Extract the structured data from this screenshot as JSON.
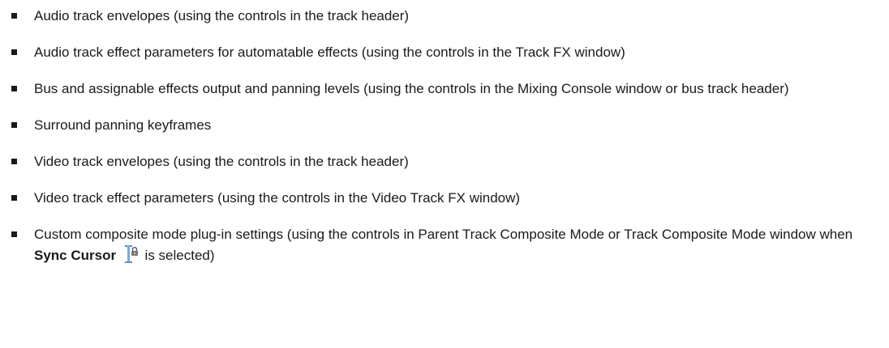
{
  "items": [
    {
      "text": "Audio track envelopes (using the controls in the track header)"
    },
    {
      "text": "Audio track effect parameters for automatable effects (using the controls in the Track FX window)"
    },
    {
      "text": "Bus and assignable effects output and panning levels (using the controls in the Mixing Console window or bus track header)"
    },
    {
      "text": "Surround panning keyframes"
    },
    {
      "text": "Video track envelopes (using the controls in the track header)"
    },
    {
      "text": "Video track effect parameters (using the controls in the Video Track FX window)"
    },
    {
      "text_before": "Custom composite mode plug-in settings (using the controls in Parent Track Composite Mode or Track Composite Mode window when ",
      "bold": "Sync Cursor",
      "icon": "sync-cursor-icon",
      "text_after": " is selected)"
    }
  ]
}
